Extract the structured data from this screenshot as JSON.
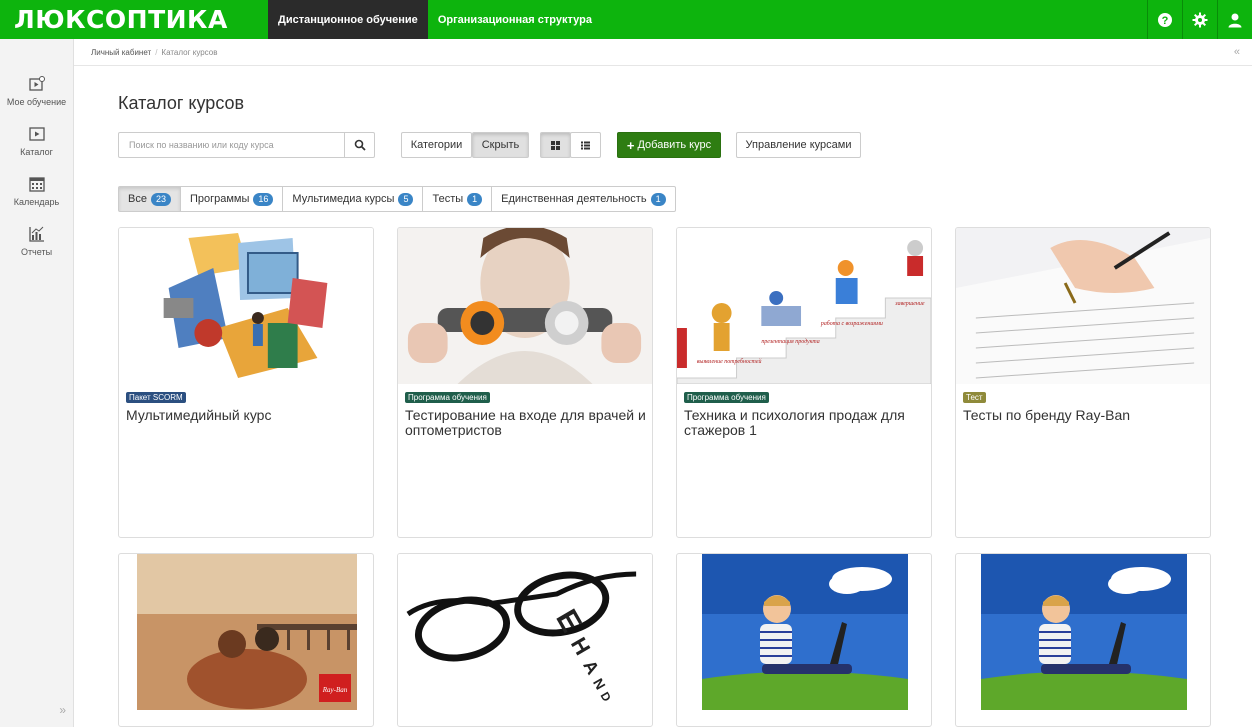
{
  "header": {
    "logo": "ЛЮКСОПТИКА",
    "nav": [
      {
        "label": "Дистанционное обучение",
        "active": true
      },
      {
        "label": "Организационная структура",
        "active": false
      }
    ],
    "icons": [
      "help-icon",
      "gear-icon",
      "user-icon"
    ],
    "brand_color": "#0db40d"
  },
  "sidebar": {
    "items": [
      {
        "label": "Мое обучение",
        "icon": "my-learning-icon"
      },
      {
        "label": "Каталог",
        "icon": "catalog-icon"
      },
      {
        "label": "Календарь",
        "icon": "calendar-icon"
      },
      {
        "label": "Отчеты",
        "icon": "reports-icon"
      }
    ],
    "expand": "»"
  },
  "breadcrumb": {
    "home": "Личный кабинет",
    "separator": "/",
    "current": "Каталог курсов",
    "collapse": "«"
  },
  "main": {
    "title": "Каталог курсов",
    "search": {
      "placeholder": "Поиск по названию или коду курса"
    },
    "categories_label": "Категории",
    "hide_label": "Скрыть",
    "add_course_label": "Добавить курс",
    "manage_label": "Управление курсами"
  },
  "filters": [
    {
      "label": "Все",
      "count": "23",
      "active": true
    },
    {
      "label": "Программы",
      "count": "16",
      "active": false
    },
    {
      "label": "Мультимедиа курсы",
      "count": "5",
      "active": false
    },
    {
      "label": "Тесты",
      "count": "1",
      "active": false
    },
    {
      "label": "Единственная деятельность",
      "count": "1",
      "active": false
    }
  ],
  "courses": [
    {
      "tag": "Пакет SCORM",
      "tag_color": "#2b4f80",
      "title": "Мультимедийный курс"
    },
    {
      "tag": "Программа обучения",
      "tag_color": "#1f5e4b",
      "title": "Тестирование на входе для врачей и оптометристов"
    },
    {
      "tag": "Программа обучения",
      "tag_color": "#1f5e4b",
      "title": "Техника и психология продаж для стажеров 1"
    },
    {
      "tag": "Тест",
      "tag_color": "#8f8a3a",
      "title": "Тесты по бренду Ray-Ban"
    },
    {
      "tag": "",
      "tag_color": "",
      "title": ""
    },
    {
      "tag": "",
      "tag_color": "",
      "title": ""
    },
    {
      "tag": "",
      "tag_color": "",
      "title": ""
    },
    {
      "tag": "",
      "tag_color": "",
      "title": ""
    }
  ]
}
